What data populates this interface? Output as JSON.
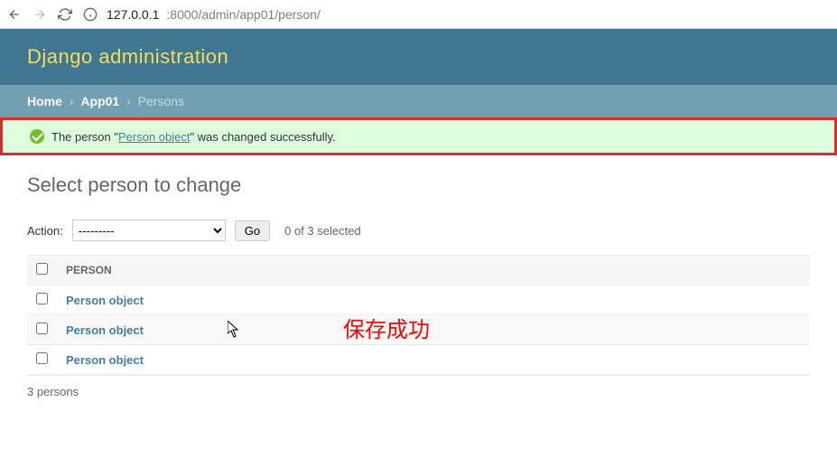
{
  "browser": {
    "url_host": "127.0.0.1",
    "url_port": ":8000",
    "url_path": "/admin/app01/person/"
  },
  "header": {
    "title": "Django administration"
  },
  "breadcrumb": {
    "home": "Home",
    "app": "App01",
    "current": "Persons"
  },
  "message": {
    "pre": "The person \"",
    "link": "Person object",
    "post": "\" was changed successfully."
  },
  "page": {
    "title": "Select person to change"
  },
  "actions": {
    "label": "Action:",
    "placeholder": "---------",
    "go": "Go",
    "selected": "0 of 3 selected"
  },
  "table": {
    "header": "PERSON",
    "rows": [
      {
        "label": "Person object"
      },
      {
        "label": "Person object"
      },
      {
        "label": "Person object"
      }
    ]
  },
  "footer": {
    "count": "3 persons"
  },
  "annotation": {
    "text": "保存成功"
  }
}
